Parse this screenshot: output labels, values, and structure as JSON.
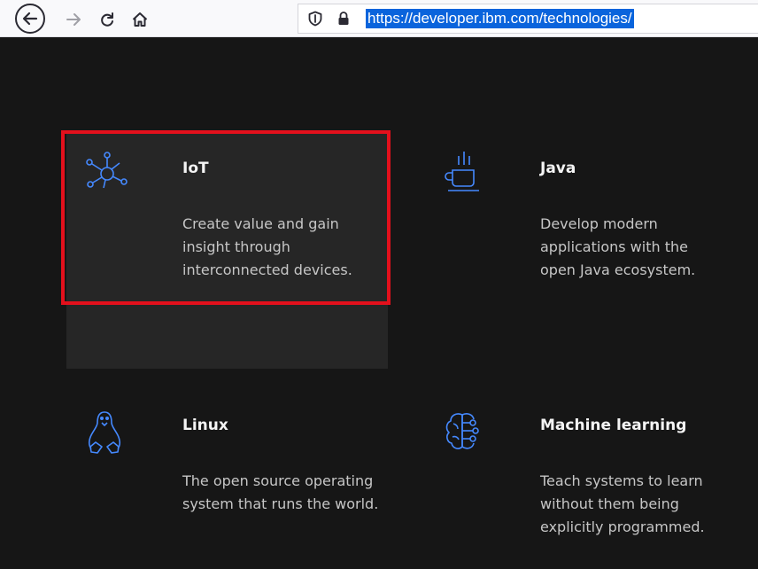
{
  "browser": {
    "url": "https://developer.ibm.com/technologies/",
    "icons": {
      "back": "arrow-left-icon",
      "forward": "arrow-right-icon",
      "reload": "reload-icon",
      "home": "home-icon",
      "tracking_protection": "shield-icon",
      "secure": "lock-icon"
    }
  },
  "colors": {
    "page_background": "#161616",
    "card_hover": "#262626",
    "icon_accent": "#4589ff",
    "highlight_frame": "#e3101c",
    "url_selection": "#0a64dc"
  },
  "cards": [
    {
      "title": "IoT",
      "description": "Create value and gain insight through interconnected devices.",
      "icon": "iot-network-icon",
      "hovered": true,
      "highlighted": true
    },
    {
      "title": "Java",
      "description": "Develop modern applications with the open Java ecosystem.",
      "icon": "java-coffee-cup-icon"
    },
    {
      "title": "Linux",
      "description": "The open source operating system that runs the world.",
      "icon": "linux-penguin-icon"
    },
    {
      "title": "Machine learning",
      "description": "Teach systems to learn without them being explicitly programmed.",
      "icon": "machine-learning-brain-icon"
    }
  ]
}
